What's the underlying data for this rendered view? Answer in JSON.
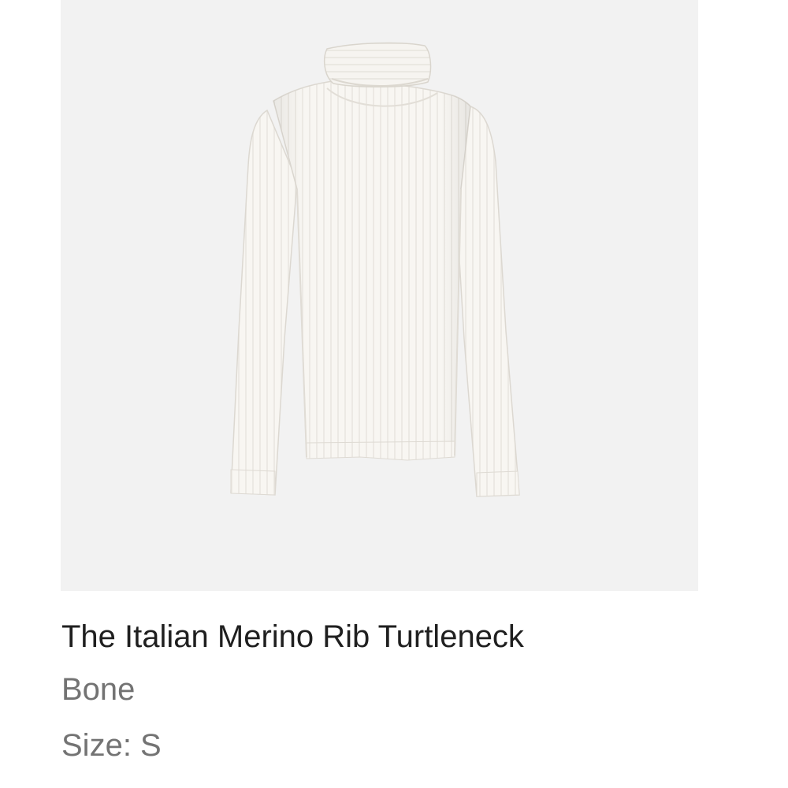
{
  "product": {
    "image_icon": "turtleneck-sweater-image",
    "title": "The Italian Merino Rib Turtleneck",
    "color": "Bone",
    "size_label": "Size: S"
  },
  "colors": {
    "image_background": "#f2f2f2",
    "garment": "#f7f5f1",
    "title_text": "#1f1f1f",
    "secondary_text": "#737373"
  }
}
